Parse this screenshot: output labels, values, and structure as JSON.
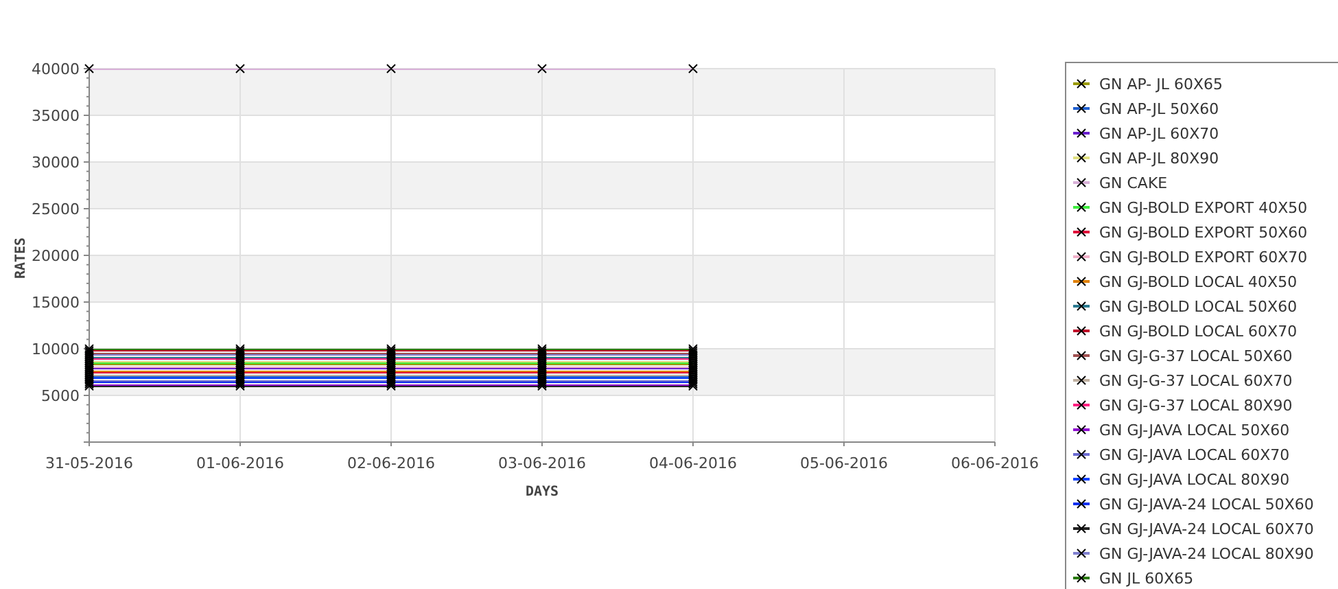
{
  "chart": {
    "chart_data": {
      "type": "line",
      "xlabel": "DAYS",
      "ylabel": "RATES",
      "grid": true,
      "categories": [
        "31-05-2016",
        "01-06-2016",
        "02-06-2016",
        "03-06-2016",
        "04-06-2016",
        "05-06-2016",
        "06-06-2016"
      ],
      "ylim": [
        0,
        40000
      ],
      "yticks": [
        5000,
        10000,
        15000,
        20000,
        25000,
        30000,
        35000,
        40000
      ],
      "series": [
        {
          "name": "GN AP- JL 60X65",
          "color": "#9a9a00",
          "marker": "x",
          "values": [
            8310,
            8310,
            8310,
            8310,
            8310,
            null,
            null
          ]
        },
        {
          "name": "GN AP-JL 50X60",
          "color": "#1f5fd0",
          "marker": "x",
          "values": [
            7050,
            7050,
            7050,
            7050,
            7050,
            null,
            null
          ]
        },
        {
          "name": "GN AP-JL 60X70",
          "color": "#6a1fd0",
          "marker": "x",
          "values": [
            7890,
            7890,
            7890,
            7890,
            7890,
            null,
            null
          ]
        },
        {
          "name": "GN AP-JL 80X90",
          "color": "#e0e080",
          "marker": "x",
          "values": [
            8730,
            8730,
            8730,
            8730,
            8730,
            null,
            null
          ]
        },
        {
          "name": "GN CAKE",
          "color": "#d8b0d8",
          "marker": "x",
          "values": [
            40000,
            40000,
            40000,
            40000,
            40000,
            null,
            null
          ]
        },
        {
          "name": "GN GJ-BOLD EXPORT 40X50",
          "color": "#40ee40",
          "marker": "x",
          "values": [
            8520,
            8520,
            8520,
            8520,
            8520,
            null,
            null
          ]
        },
        {
          "name": "GN GJ-BOLD EXPORT 50X60",
          "color": "#e0103a",
          "marker": "x",
          "values": [
            7470,
            7470,
            7470,
            7470,
            7470,
            null,
            null
          ]
        },
        {
          "name": "GN GJ-BOLD EXPORT 60X70",
          "color": "#f0b0c8",
          "marker": "x",
          "values": [
            8100,
            8100,
            8100,
            8100,
            8100,
            null,
            null
          ]
        },
        {
          "name": "GN GJ-BOLD LOCAL 40X50",
          "color": "#e08000",
          "marker": "x",
          "values": [
            7680,
            7680,
            7680,
            7680,
            7680,
            null,
            null
          ]
        },
        {
          "name": "GN GJ-BOLD LOCAL 50X60",
          "color": "#2a7a90",
          "marker": "x",
          "values": [
            9150,
            9150,
            9150,
            9150,
            9150,
            null,
            null
          ]
        },
        {
          "name": "GN GJ-BOLD LOCAL 60X70",
          "color": "#c0102a",
          "marker": "x",
          "values": [
            9780,
            9780,
            9780,
            9780,
            9780,
            null,
            null
          ]
        },
        {
          "name": "GN GJ-G-37 LOCAL 50X60",
          "color": "#a05050",
          "marker": "x",
          "values": [
            9570,
            9570,
            9570,
            9570,
            9570,
            null,
            null
          ]
        },
        {
          "name": "GN GJ-G-37 LOCAL 60X70",
          "color": "#c0b0a0",
          "marker": "x",
          "values": [
            7260,
            7260,
            7260,
            7260,
            7260,
            null,
            null
          ]
        },
        {
          "name": "GN GJ-G-37 LOCAL 80X90",
          "color": "#ff2080",
          "marker": "x",
          "values": [
            8940,
            8940,
            8940,
            8940,
            8940,
            null,
            null
          ]
        },
        {
          "name": "GN GJ-JAVA LOCAL 50X60",
          "color": "#9010d0",
          "marker": "x",
          "values": [
            6210,
            6210,
            6210,
            6210,
            6210,
            null,
            null
          ]
        },
        {
          "name": "GN GJ-JAVA LOCAL 60X70",
          "color": "#6a6ad0",
          "marker": "x",
          "values": [
            6630,
            6630,
            6630,
            6630,
            6630,
            null,
            null
          ]
        },
        {
          "name": "GN GJ-JAVA LOCAL 80X90",
          "color": "#1040ff",
          "marker": "x",
          "values": [
            6840,
            6840,
            6840,
            6840,
            6840,
            null,
            null
          ]
        },
        {
          "name": "GN GJ-JAVA-24 LOCAL 50X60",
          "color": "#1030f0",
          "marker": "x",
          "values": [
            6420,
            6420,
            6420,
            6420,
            6420,
            null,
            null
          ]
        },
        {
          "name": "GN GJ-JAVA-24 LOCAL 60X70",
          "color": "#202020",
          "marker": "x",
          "values": [
            6000,
            6000,
            6000,
            6000,
            6000,
            null,
            null
          ]
        },
        {
          "name": "GN GJ-JAVA-24 LOCAL 80X90",
          "color": "#8080d0",
          "marker": "x",
          "values": [
            9360,
            9360,
            9360,
            9360,
            9360,
            null,
            null
          ]
        },
        {
          "name": "GN JL 60X65",
          "color": "#2a7a10",
          "marker": "x",
          "values": [
            9990,
            9990,
            9990,
            9990,
            9990,
            null,
            null
          ]
        }
      ]
    }
  }
}
